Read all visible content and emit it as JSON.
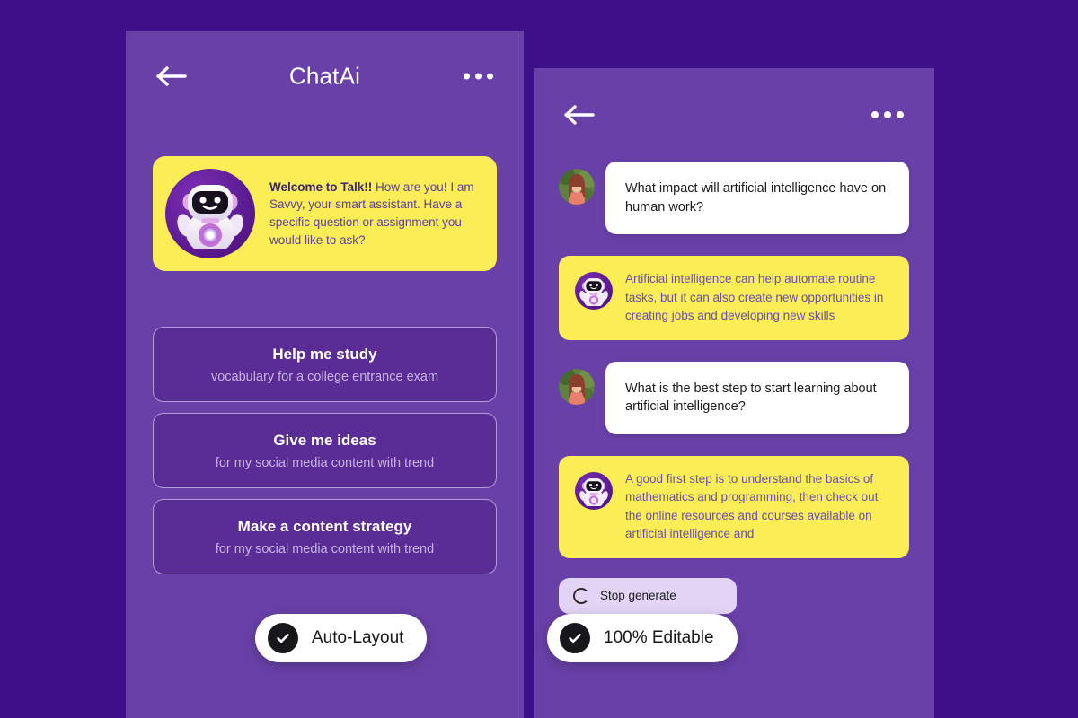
{
  "colors": {
    "page_background": "#3d1089",
    "panel_background": "#6940a8",
    "accent_yellow": "#fbed55",
    "card_fill": "#5a2d96",
    "card_border": "#b69ad8",
    "badge_dark": "#17171a",
    "stop_pill": "#e3d4f5"
  },
  "left_panel": {
    "header": {
      "back_icon": "back-arrow-icon",
      "title": "ChatAi",
      "menu_icon": "more-options-icon"
    },
    "welcome_card": {
      "avatar_icon": "robot-avatar-icon",
      "bold_lead": "Welcome to Talk!!",
      "body": " How are you! I am Savvy, your smart assistant. Have a specific question or assignment you would like to ask?"
    },
    "suggestions": [
      {
        "title": "Help me study",
        "subtitle": "vocabulary for a college entrance exam"
      },
      {
        "title": "Give me ideas",
        "subtitle": "for my social media content with trend"
      },
      {
        "title": "Make a content strategy",
        "subtitle": "for my social media content with trend"
      }
    ]
  },
  "right_panel": {
    "header": {
      "back_icon": "back-arrow-icon",
      "menu_icon": "more-options-icon"
    },
    "messages": [
      {
        "role": "user",
        "avatar_icon": "user-avatar-photo",
        "text": "What impact will artificial intelligence have on human work?"
      },
      {
        "role": "ai",
        "avatar_icon": "robot-avatar-icon",
        "text": "Artificial intelligence can help automate routine tasks, but it can also create new opportunities in creating jobs and developing new skills"
      },
      {
        "role": "user",
        "avatar_icon": "user-avatar-photo",
        "text": "What is the best step to start learning about artificial intelligence?"
      },
      {
        "role": "ai",
        "avatar_icon": "robot-avatar-icon",
        "text": "A good first step is to understand the basics of mathematics and programming, then check out the online resources and courses available on artificial intelligence and"
      }
    ],
    "stop_generate": {
      "icon": "spinner-icon",
      "label": "Stop generate"
    }
  },
  "badges": [
    {
      "icon": "check-circle-icon",
      "label": "Auto-Layout"
    },
    {
      "icon": "check-circle-icon",
      "label": "100% Editable"
    }
  ]
}
